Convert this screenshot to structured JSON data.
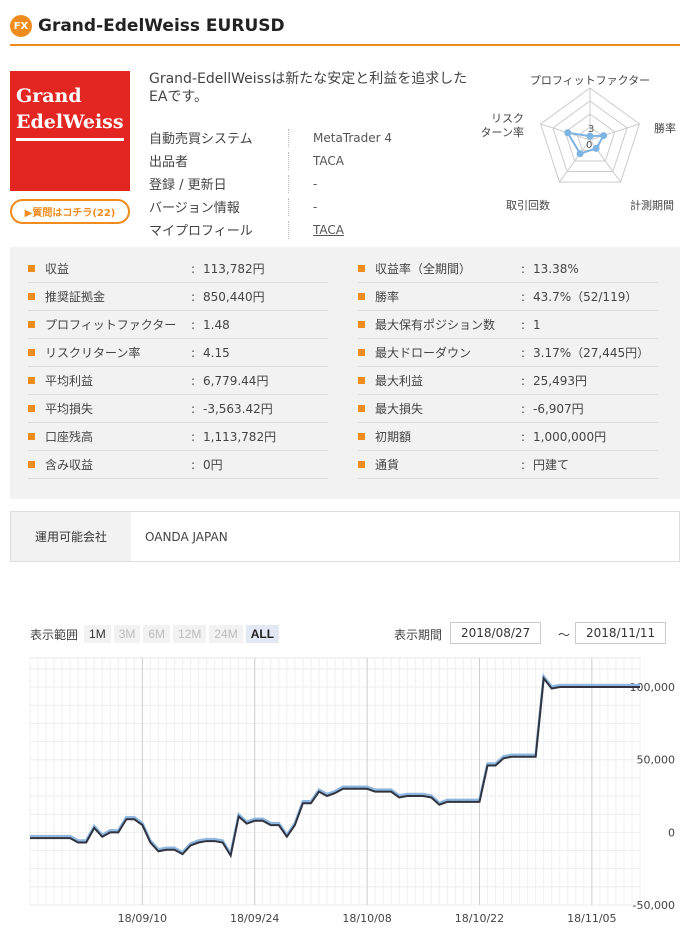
{
  "header": {
    "badge": "FX",
    "title": "Grand-EdelWeiss EURUSD"
  },
  "logo": {
    "line1": "Grand",
    "line2": "EdelWeiss"
  },
  "buy_button": "▶質問はコチラ(22)",
  "description": "Grand-EdellWeissは新たな安定と利益を追求したEAです。",
  "info": [
    {
      "label": "自動売買システム",
      "value": "MetaTrader 4"
    },
    {
      "label": "出品者",
      "value": "TACA"
    },
    {
      "label": "登録 / 更新日",
      "value": "-"
    },
    {
      "label": "バージョン情報",
      "value": "-"
    },
    {
      "label": "マイプロフィール",
      "value": "TACA"
    }
  ],
  "radar": {
    "axes": [
      "プロフィットファクター",
      "勝率",
      "計測期間",
      "取引回数",
      "リスクリターン率"
    ],
    "axis_lines": [
      "リスク",
      "ターン率"
    ],
    "tick_max": "3",
    "tick_min": "0",
    "values": [
      0.3,
      1.1,
      0.8,
      1.3,
      1.8
    ],
    "max": 4,
    "color": "#7cb4e4"
  },
  "stats_left": [
    {
      "label": "収益",
      "value": "113,782円"
    },
    {
      "label": "推奨証拠金",
      "value": "850,440円"
    },
    {
      "label": "プロフィットファクター",
      "value": "1.48"
    },
    {
      "label": "リスクリターン率",
      "value": "4.15"
    },
    {
      "label": "平均利益",
      "value": "6,779.44円"
    },
    {
      "label": "平均損失",
      "value": "-3,563.42円"
    },
    {
      "label": "口座残高",
      "value": "1,113,782円"
    },
    {
      "label": "含み収益",
      "value": "0円"
    }
  ],
  "stats_right": [
    {
      "label": "収益率（全期間）",
      "value": "13.38%"
    },
    {
      "label": "勝率",
      "value": "43.7%（52/119）"
    },
    {
      "label": "最大保有ポジション数",
      "value": "1"
    },
    {
      "label": "最大ドローダウン",
      "value": "3.17%（27,445円）"
    },
    {
      "label": "最大利益",
      "value": "25,493円"
    },
    {
      "label": "最大損失",
      "value": "-6,907円"
    },
    {
      "label": "初期額",
      "value": "1,000,000円"
    },
    {
      "label": "通貨",
      "value": "円建て"
    }
  ],
  "company": {
    "label": "運用可能会社",
    "value": "OANDA JAPAN"
  },
  "range": {
    "label": "表示範囲",
    "buttons": [
      "1M",
      "3M",
      "6M",
      "12M",
      "24M",
      "ALL"
    ],
    "period_label": "表示期間",
    "from": "2018/08/27",
    "tilde": "～",
    "to": "2018/11/11"
  },
  "chart_data": {
    "type": "line",
    "x_tick_labels": [
      "18/09/10",
      "18/09/24",
      "18/10/08",
      "18/10/22",
      "18/11/05"
    ],
    "y_tick_labels": [
      "100,000",
      "50,000",
      "0",
      "-50,000"
    ],
    "ylim": [
      -50000,
      120000
    ],
    "xlim": [
      0,
      76
    ],
    "x_tick_positions": [
      14,
      28,
      42,
      56,
      70
    ],
    "series": [
      {
        "color": "#2f3440",
        "x": [
          0,
          1,
          2,
          3,
          4,
          5,
          6,
          7,
          8,
          9,
          10,
          11,
          12,
          13,
          14,
          15,
          16,
          17,
          18,
          19,
          20,
          21,
          22,
          23,
          24,
          25,
          26,
          27,
          28,
          29,
          30,
          31,
          32,
          33,
          34,
          35,
          36,
          37,
          38,
          39,
          40,
          41,
          42,
          43,
          44,
          45,
          46,
          47,
          48,
          49,
          50,
          51,
          52,
          53,
          54,
          55,
          56,
          57,
          58,
          59,
          60,
          61,
          62,
          63,
          64,
          65,
          66,
          67,
          68,
          69,
          70,
          71,
          72,
          73,
          74,
          75,
          76
        ],
        "y": [
          -4000,
          -4000,
          -4000,
          -4000,
          -4000,
          -4000,
          -7000,
          -7000,
          3000,
          -3000,
          0,
          0,
          9000,
          9000,
          5000,
          -7000,
          -13000,
          -12000,
          -12000,
          -15000,
          -9000,
          -7000,
          -6000,
          -6000,
          -7000,
          -16000,
          11000,
          6000,
          8000,
          8000,
          5000,
          5000,
          -3000,
          5000,
          20000,
          20000,
          28000,
          25000,
          27000,
          30000,
          30000,
          30000,
          30000,
          28000,
          28000,
          28000,
          24000,
          25000,
          25000,
          25000,
          24000,
          19000,
          21000,
          21000,
          21000,
          21000,
          21000,
          46000,
          46000,
          51000,
          52000,
          52000,
          52000,
          52000,
          106000,
          99000,
          100000,
          100000,
          100000,
          100000,
          100000,
          100000,
          100000,
          100000,
          100000,
          100000,
          100000
        ]
      }
    ]
  }
}
